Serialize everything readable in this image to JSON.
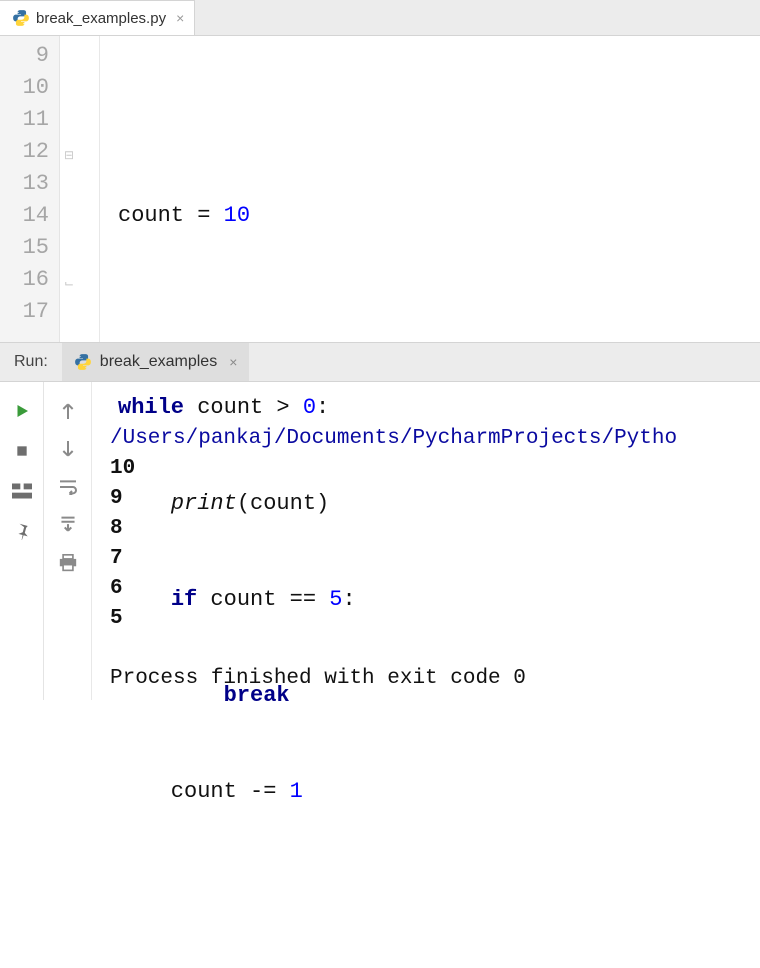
{
  "editor": {
    "tab": {
      "filename": "break_examples.py"
    },
    "line_numbers": [
      "9",
      "10",
      "11",
      "12",
      "13",
      "14",
      "15",
      "16",
      "17"
    ],
    "code": {
      "l10": {
        "a": "count = ",
        "b": "10"
      },
      "l12": {
        "a": "while",
        "b": " count > ",
        "c": "0",
        "d": ":"
      },
      "l13": {
        "a": "    ",
        "b": "print",
        "c": "(count)"
      },
      "l14": {
        "a": "    ",
        "b": "if",
        "c": " count == ",
        "d": "5",
        "e": ":"
      },
      "l15": {
        "a": "        ",
        "b": "break"
      },
      "l16": {
        "a": "    count -= ",
        "b": "1"
      }
    }
  },
  "run": {
    "label": "Run:",
    "tab_name": "break_examples",
    "output": {
      "path": "/Users/pankaj/Documents/PycharmProjects/Pytho",
      "lines": [
        "10",
        "9",
        "8",
        "7",
        "6",
        "5"
      ],
      "exit_msg": "Process finished with exit code 0"
    }
  }
}
